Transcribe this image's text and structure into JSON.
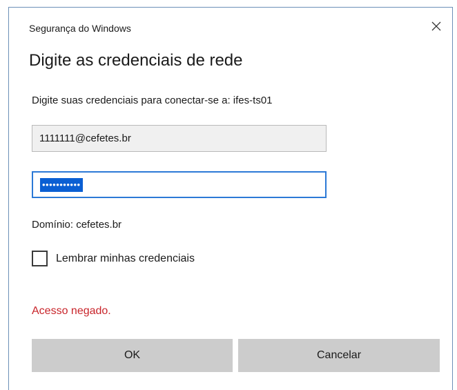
{
  "window": {
    "title": "Segurança do Windows"
  },
  "dialog": {
    "heading": "Digite as credenciais de rede",
    "prompt": "Digite suas credenciais para conectar-se a: ifes-ts01",
    "username": {
      "value": "1111111@cefetes.br"
    },
    "password": {
      "masked_value": "•••••••••••"
    },
    "domain_text": "Domínio: cefetes.br",
    "remember": {
      "label": "Lembrar minhas credenciais",
      "checked": false
    },
    "error_text": "Acesso negado.",
    "ok_label": "OK",
    "cancel_label": "Cancelar"
  },
  "icons": {
    "close": "close-icon"
  },
  "colors": {
    "error": "#c8242a",
    "focus_border": "#2b79d6",
    "selection": "#0a5fd3",
    "button": "#cccccc"
  }
}
